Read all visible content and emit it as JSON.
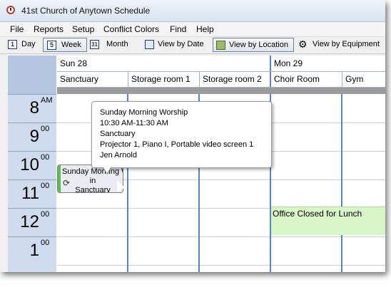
{
  "window": {
    "title": "41st Church of Anytown Schedule"
  },
  "menu": {
    "items": [
      "File",
      "Reports",
      "Setup",
      "Conflict Colors",
      "Find",
      "Help"
    ]
  },
  "toolbar": {
    "day": {
      "icon_num": "1",
      "label": "Day"
    },
    "week": {
      "icon_num": "5",
      "label": "Week"
    },
    "month": {
      "icon_num": "31",
      "label": "Month"
    },
    "view_by_date": "View by Date",
    "view_by_location": "View by Location",
    "view_by_equipment": "View by Equipment"
  },
  "calendar": {
    "days": [
      "Sun 28",
      "Mon 29"
    ],
    "columns": [
      "Sanctuary",
      "Storage room 1",
      "Storage room 2",
      "Choir Room",
      "Gym"
    ],
    "hours": [
      {
        "num": "8",
        "suffix": "AM"
      },
      {
        "num": "9",
        "suffix": "00"
      },
      {
        "num": "10",
        "suffix": "00"
      },
      {
        "num": "11",
        "suffix": "00"
      },
      {
        "num": "12",
        "suffix": "00"
      },
      {
        "num": "1",
        "suffix": "00"
      }
    ]
  },
  "event": {
    "title": "Sunday Morning Worship",
    "in_word": "in",
    "location": "Sanctuary",
    "accent_color": "#56c04b"
  },
  "closed": {
    "label": "Office Closed for Lunch",
    "color": "#d8f5c8"
  },
  "tooltip": {
    "title": "Sunday Morning Worship",
    "time": "10:30 AM-11:30 AM",
    "location": "Sanctuary",
    "equipment": "Projector 1, Piano I, Portable video screen 1",
    "person": "Jen Arnold"
  }
}
